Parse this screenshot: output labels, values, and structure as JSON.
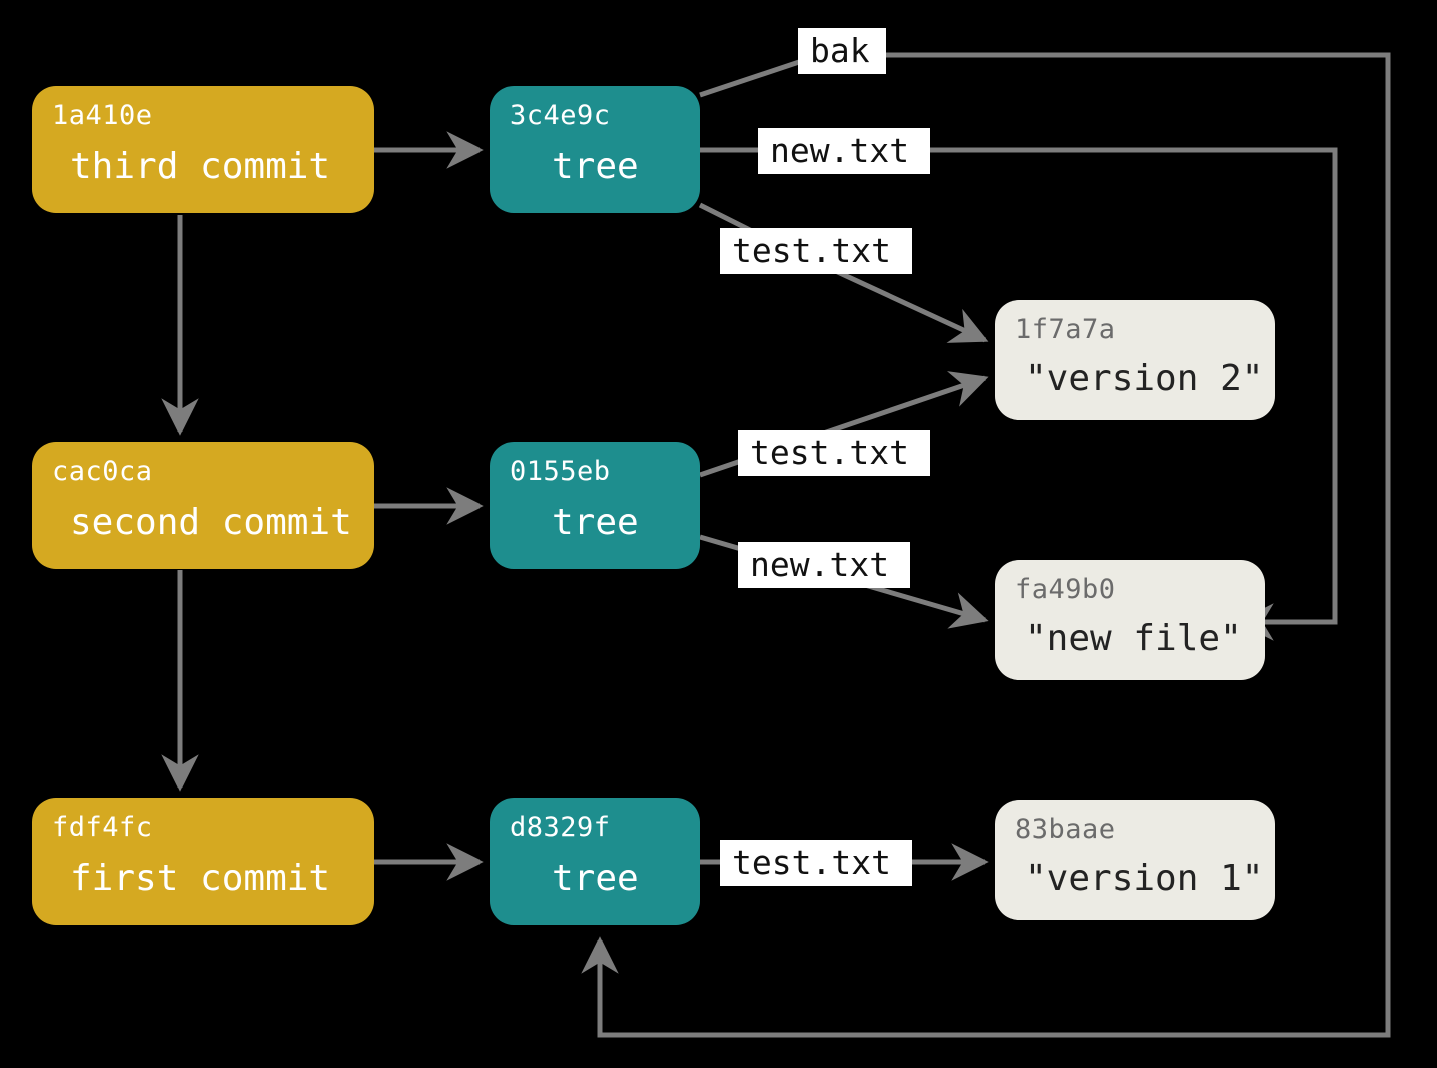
{
  "commits": [
    {
      "hash": "1a410e",
      "msg": "third commit"
    },
    {
      "hash": "cac0ca",
      "msg": "second commit"
    },
    {
      "hash": "fdf4fc",
      "msg": "first commit"
    }
  ],
  "trees": [
    {
      "hash": "3c4e9c",
      "msg": "tree"
    },
    {
      "hash": "0155eb",
      "msg": "tree"
    },
    {
      "hash": "d8329f",
      "msg": "tree"
    }
  ],
  "blobs": [
    {
      "hash": "1f7a7a",
      "msg": "\"version 2\""
    },
    {
      "hash": "fa49b0",
      "msg": "\"new file\""
    },
    {
      "hash": "83baae",
      "msg": "\"version 1\""
    }
  ],
  "labels": {
    "bak": "bak",
    "newtxt1": "new.txt",
    "testtxt1": "test.txt",
    "testtxt2": "test.txt",
    "newtxt2": "new.txt",
    "testtxt3": "test.txt"
  }
}
